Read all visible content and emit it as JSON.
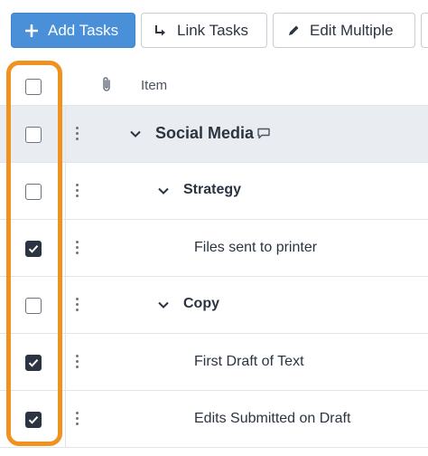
{
  "toolbar": {
    "add_tasks": "Add Tasks",
    "link_tasks": "Link Tasks",
    "edit_multiple": "Edit Multiple"
  },
  "table": {
    "header": {
      "item_label": "Item",
      "attachment_icon": "paperclip-icon",
      "checked": false
    },
    "rows": [
      {
        "label": "Social Media",
        "level": 0,
        "expanded": true,
        "has_comment": true,
        "checked": false
      },
      {
        "label": "Strategy",
        "level": 1,
        "expanded": true,
        "checked": false
      },
      {
        "label": "Files sent to printer",
        "level": 2,
        "checked": true
      },
      {
        "label": "Copy",
        "level": 1,
        "expanded": true,
        "checked": false
      },
      {
        "label": "First Draft of Text",
        "level": 2,
        "checked": true
      },
      {
        "label": "Edits Submitted on Draft",
        "level": 2,
        "checked": true
      }
    ]
  },
  "colors": {
    "primary": "#4a90d9",
    "highlight": "#f0921f",
    "group_row_bg": "#e9edf1",
    "checkbox_checked": "#2b3440"
  }
}
